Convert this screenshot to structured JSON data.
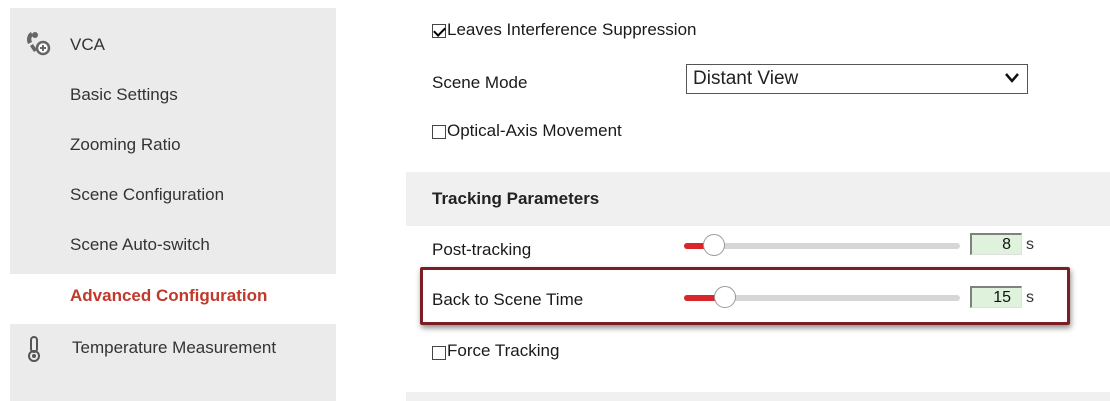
{
  "sidebar": {
    "items": [
      {
        "label": "VCA",
        "icon": "vca-camera-icon"
      },
      {
        "label": "Basic Settings"
      },
      {
        "label": "Zooming Ratio"
      },
      {
        "label": "Scene Configuration"
      },
      {
        "label": "Scene Auto-switch"
      },
      {
        "label": "Advanced Configuration",
        "active": true
      },
      {
        "label": "Temperature Measurement",
        "icon": "thermometer-icon"
      }
    ]
  },
  "settings": {
    "leaves_interference_suppression": {
      "label": "Leaves Interference Suppression",
      "checked": true
    },
    "scene_mode": {
      "label": "Scene Mode",
      "value": "Distant View"
    },
    "optical_axis_movement": {
      "label": "Optical-Axis Movement",
      "checked": false
    }
  },
  "tracking_parameters": {
    "title": "Tracking Parameters",
    "post_tracking": {
      "label": "Post-tracking",
      "value": "8",
      "unit": "s",
      "slider_fraction": 0.11
    },
    "back_to_scene_time": {
      "label": "Back to Scene Time",
      "value": "15",
      "unit": "s",
      "slider_fraction": 0.15
    },
    "force_tracking": {
      "label": "Force Tracking",
      "checked": false
    }
  },
  "colors": {
    "accent": "#c0392b",
    "slider_fill": "#d9262b",
    "input_bg": "#dff2dc",
    "highlight_border": "#7a1e22",
    "sidebar_bg": "#ebebeb"
  }
}
